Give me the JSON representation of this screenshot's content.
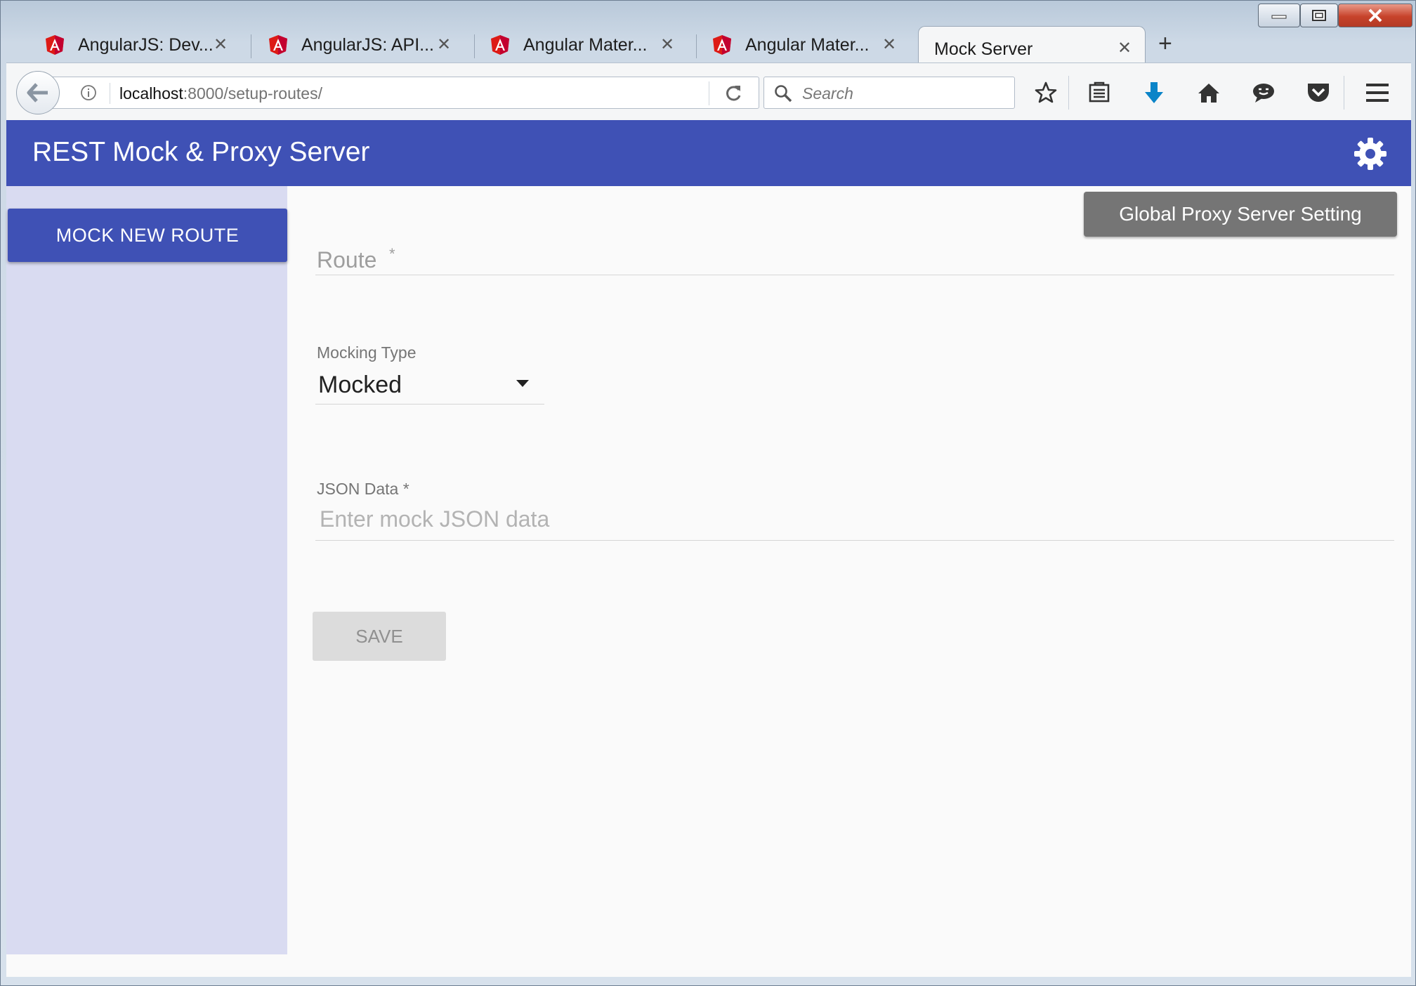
{
  "browser": {
    "tabs": [
      {
        "label": "AngularJS: Dev...",
        "icon": "angular-icon"
      },
      {
        "label": "AngularJS: API...",
        "icon": "angular-icon"
      },
      {
        "label": "Angular Mater...",
        "icon": "angular-icon"
      },
      {
        "label": "Angular Mater...",
        "icon": "angular-icon"
      },
      {
        "label": "Mock Server",
        "icon": ""
      }
    ],
    "url_host": "localhost",
    "url_rest": ":8000/setup-routes/",
    "search_placeholder": "Search",
    "toolbar_icons": [
      "star-bookmark-icon",
      "reader-list-icon",
      "download-icon",
      "home-icon",
      "chat-icon",
      "pocket-icon",
      "hamburger-menu-icon"
    ]
  },
  "app": {
    "title": "REST Mock & Proxy Server",
    "settings_icon": "gear-icon",
    "primary_color": "#3f51b5",
    "sidebar": {
      "mock_new_route_label": "MOCK NEW ROUTE"
    },
    "global_proxy_label": "Global Proxy Server Setting",
    "form": {
      "route_placeholder": "Route",
      "route_required_mark": "*",
      "mocking_type_label": "Mocking Type",
      "mocking_type_value": "Mocked",
      "json_label": "JSON Data *",
      "json_placeholder": "Enter mock JSON data",
      "save_label": "SAVE"
    }
  }
}
